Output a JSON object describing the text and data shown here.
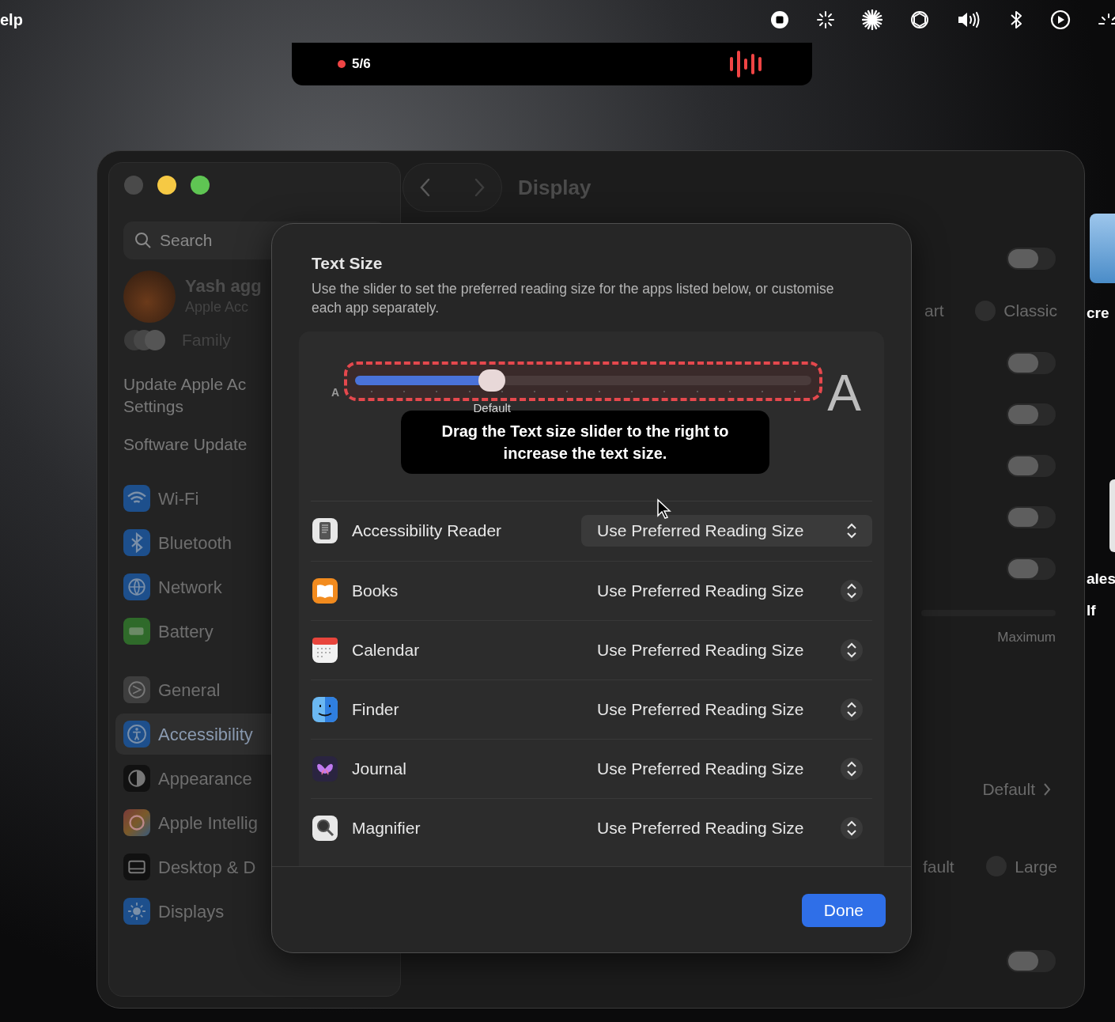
{
  "menu_bar": {
    "app_menu": "elp"
  },
  "recording_pill": {
    "counter": "5/6"
  },
  "window": {
    "title": "Display",
    "sidebar": {
      "search": {
        "placeholder": "Search"
      },
      "account": {
        "name": "Yash agg",
        "subtitle": "Apple Acc"
      },
      "family": "Family",
      "notices": [
        {
          "lines": [
            "Update Apple Ac",
            "Settings"
          ]
        },
        {
          "lines": [
            "Software Update"
          ]
        }
      ],
      "items": [
        {
          "label": "Wi-Fi",
          "selected": false
        },
        {
          "label": "Bluetooth",
          "selected": false
        },
        {
          "label": "Network",
          "selected": false
        },
        {
          "label": "Battery",
          "selected": false
        },
        {
          "label": "General",
          "selected": false
        },
        {
          "label": "Accessibility",
          "selected": true
        },
        {
          "label": "Appearance",
          "selected": false
        },
        {
          "label": "Apple Intellig",
          "selected": false
        },
        {
          "label": "Desktop & D",
          "selected": false
        },
        {
          "label": "Displays",
          "selected": false
        }
      ]
    },
    "content": {
      "toggles": [
        {
          "on": false
        },
        {
          "on": false
        },
        {
          "on": false
        },
        {
          "on": false
        },
        {
          "on": false
        },
        {
          "on": false
        },
        {
          "on": false
        }
      ],
      "radio_row_1": {
        "left": "art",
        "right": "Classic",
        "selected": false
      },
      "slider_max_label": "Maximum",
      "popup_value": "Default",
      "radio_row_2": {
        "left": "fault",
        "right": "Large",
        "selected": false
      }
    }
  },
  "right_window": {
    "texts": [
      "cre",
      "ales",
      "lf"
    ]
  },
  "sheet": {
    "title": "Text Size",
    "description": "Use the slider to set the preferred reading size for the apps listed below, or customise each app separately.",
    "slider": {
      "min_label": "A",
      "max_label": "A",
      "tick_label": "Default",
      "level": 0.3,
      "highlighted": true
    },
    "tooltip": "Drag the Text size slider to the right to increase the text size.",
    "apps": [
      {
        "name": "Accessibility Reader",
        "value": "Use Preferred Reading Size",
        "hovered": true
      },
      {
        "name": "Books",
        "value": "Use Preferred Reading Size",
        "hovered": false
      },
      {
        "name": "Calendar",
        "value": "Use Preferred Reading Size",
        "hovered": false
      },
      {
        "name": "Finder",
        "value": "Use Preferred Reading Size",
        "hovered": false
      },
      {
        "name": "Journal",
        "value": "Use Preferred Reading Size",
        "hovered": false
      },
      {
        "name": "Magnifier",
        "value": "Use Preferred Reading Size",
        "hovered": false
      }
    ],
    "done_button": "Done"
  }
}
